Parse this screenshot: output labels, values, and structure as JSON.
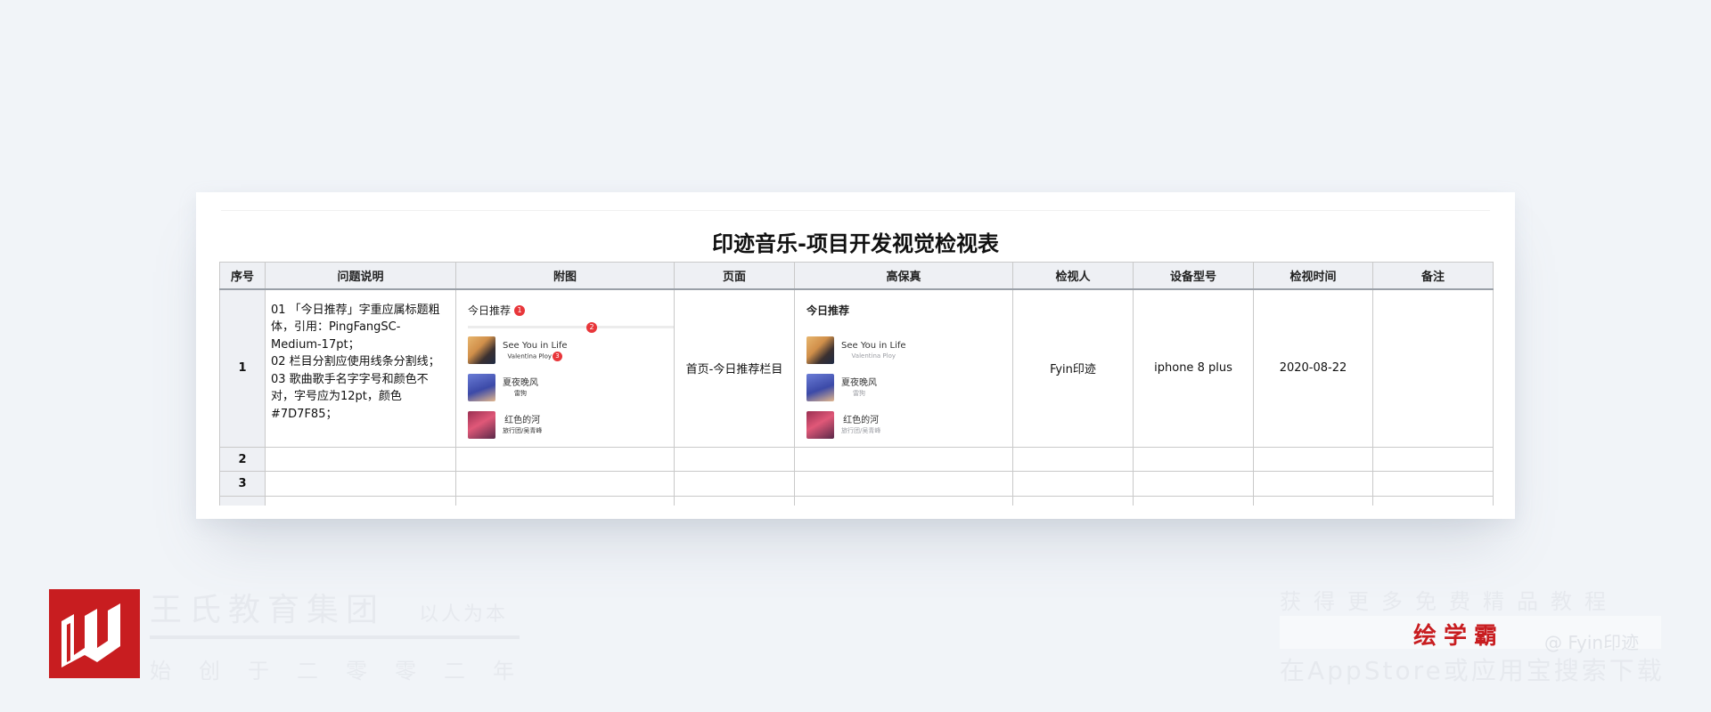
{
  "title": "印迹音乐-项目开发视觉检视表",
  "table": {
    "headers": [
      "序号",
      "问题说明",
      "附图",
      "页面",
      "高保真",
      "检视人",
      "设备型号",
      "检视时间",
      "备注"
    ],
    "rows": [
      {
        "seq": "1",
        "issue_lines": [
          "01 「今日推荐」字重应属标题粗",
          "体，引用：PingFangSC-",
          "Medium-17pt；",
          "02 栏目分割应使用线条分割线；",
          "03 歌曲歌手名字字号和颜色不",
          "对，字号应为12pt，颜色",
          "#7D7F85；"
        ],
        "page": "首页-今日推荐栏目",
        "reviewer": "Fyin印迹",
        "device": "iphone 8 plus",
        "date": "2020-08-22",
        "note": ""
      },
      {
        "seq": "2"
      },
      {
        "seq": "3"
      }
    ]
  },
  "attachment": {
    "title": "今日推荐",
    "badges": [
      "1",
      "2",
      "3"
    ],
    "songs": [
      {
        "name": "See You in Life",
        "singer": "Valentina Ploy"
      },
      {
        "name": "夏夜晚风",
        "singer": "雷狗"
      },
      {
        "name": "红色的河",
        "singer": "旅行团/吴青峰"
      }
    ]
  },
  "hifi": {
    "title": "今日推荐",
    "songs": [
      {
        "name": "See You in Life",
        "singer": "Valentina Ploy"
      },
      {
        "name": "夏夜晚风",
        "singer": "雷狗"
      },
      {
        "name": "红色的河",
        "singer": "旅行团/吴青峰"
      }
    ]
  },
  "footer": {
    "brand_name": "王氏教育集团",
    "slogan": "以人为本",
    "since": "始创于二零零二年",
    "promo_line1": "获得更多免费精品教程",
    "promo_app": "绘学霸",
    "promo_at": "@ Fyin印迹",
    "promo_line3": "在AppStore或应用宝搜索下载"
  },
  "colors": {
    "background": "#f1f4f8",
    "badge_red": "#e8363a",
    "brand_red": "#c81d20",
    "header_bg": "#eef0f4",
    "singer_gray": "#7D7F85"
  }
}
